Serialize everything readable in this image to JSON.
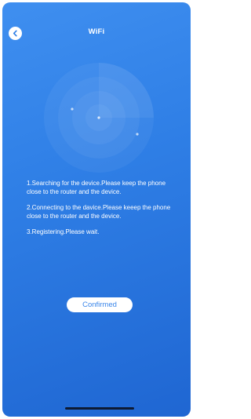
{
  "header": {
    "title": "WiFi",
    "back_icon": "chevron-left-icon"
  },
  "steps": [
    "1.Searching for the device.Please keep the phone close to the router and the device.",
    "2.Connecting to the davice.Please keeep the phone close to the router and the device.",
    "3.Registering.Please wait."
  ],
  "actions": {
    "confirm_label": "Confirmed"
  },
  "colors": {
    "background_top": "#3f8ff0",
    "background_bottom": "#1f66d2",
    "button_text": "#3a86ea"
  }
}
